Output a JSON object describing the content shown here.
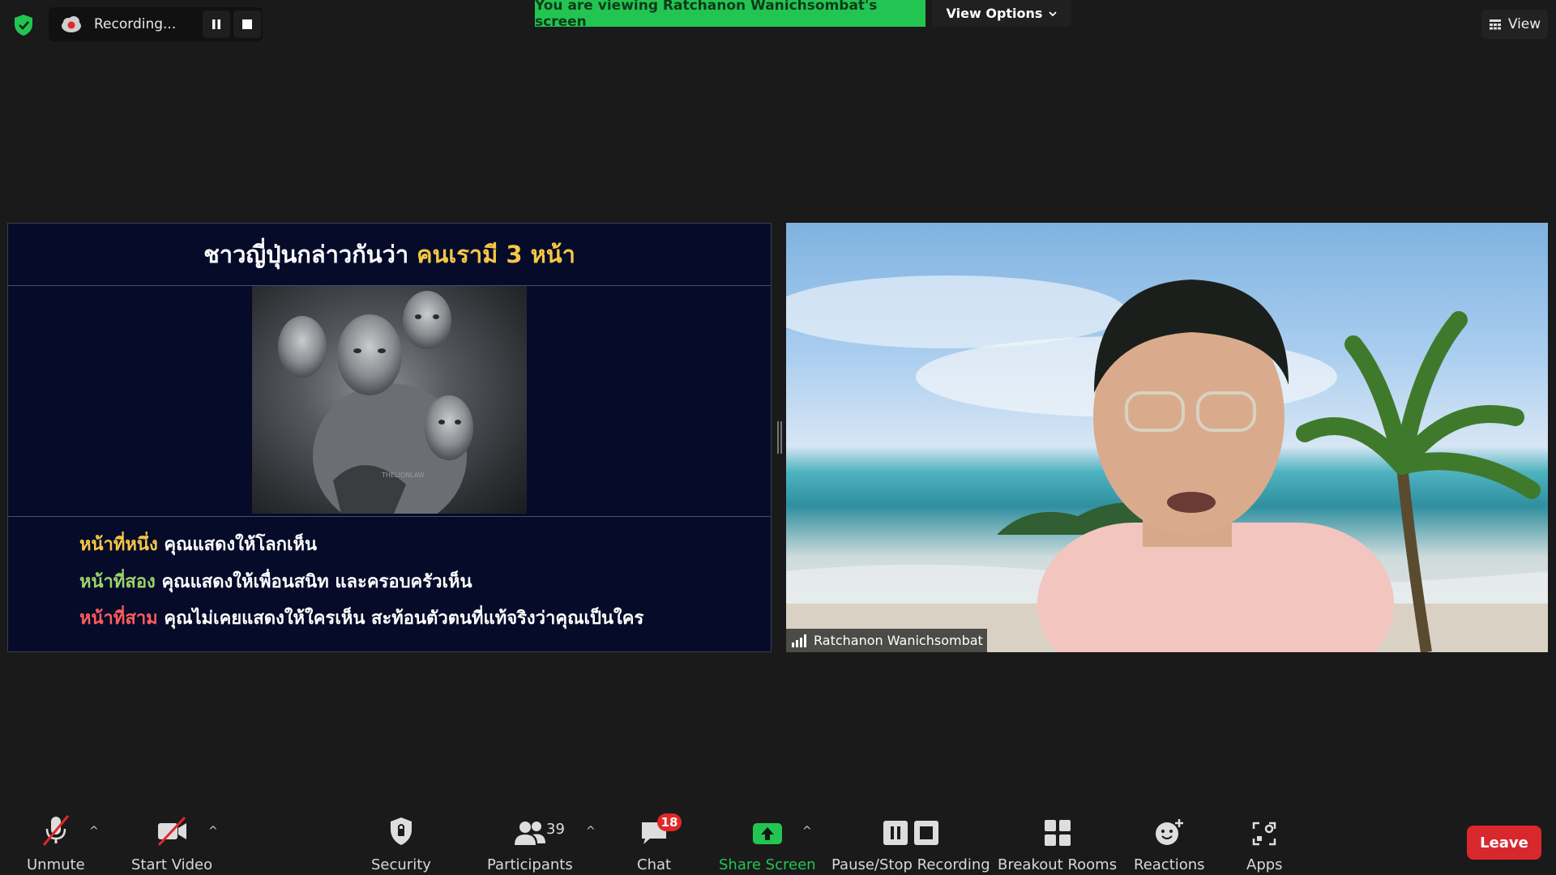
{
  "top_bar": {
    "recording_label": "Recording...",
    "viewing_banner": "You are viewing Ratchanon Wanichsombat's screen",
    "view_options_label": "View Options",
    "view_label": "View"
  },
  "slide": {
    "title_prefix": "ชาวญี่ปุ่นกล่าวกันว่า",
    "title_highlight": "คนเรามี 3 หน้า",
    "image_watermark": "THELIONLAW",
    "lines": [
      {
        "key": "หน้าที่หนึ่ง",
        "text": "คุณแสดงให้โลกเห็น"
      },
      {
        "key": "หน้าที่สอง",
        "text": "คุณแสดงให้เพื่อนสนิท และครอบครัวเห็น"
      },
      {
        "key": "หน้าที่สาม",
        "text": "คุณไม่เคยแสดงให้ใครเห็น สะท้อนตัวตนที่แท้จริงว่าคุณเป็นใคร"
      }
    ]
  },
  "video": {
    "participant_name": "Ratchanon Wanichsombat"
  },
  "toolbar": {
    "unmute": "Unmute",
    "start_video": "Start Video",
    "security": "Security",
    "participants": "Participants",
    "participants_count": "39",
    "chat": "Chat",
    "chat_badge": "18",
    "share_screen": "Share Screen",
    "pause_stop_recording": "Pause/Stop Recording",
    "breakout_rooms": "Breakout Rooms",
    "reactions": "Reactions",
    "apps": "Apps",
    "leave": "Leave"
  },
  "colors": {
    "banner_green": "#23c552",
    "share_green": "#23c552",
    "leave_red": "#d9272e",
    "badge_red": "#e02828",
    "slide_highlight": "#f6c744"
  }
}
